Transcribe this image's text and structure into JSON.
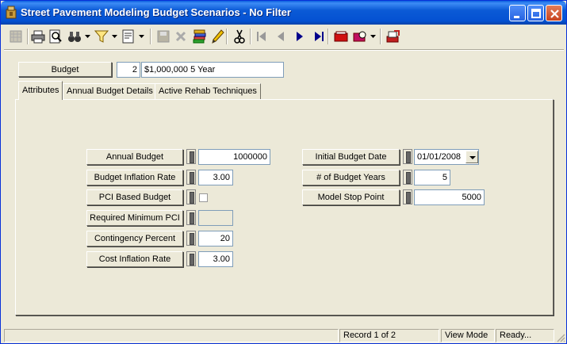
{
  "window": {
    "title": "Street Pavement Modeling Budget Scenarios - No Filter"
  },
  "toolbar": {
    "icons": [
      "grid-icon",
      "print-icon",
      "print-preview-icon",
      "binoculars-icon",
      "filter-icon",
      "form-icon",
      "save-icon",
      "delete-icon",
      "add-icon",
      "edit-icon",
      "cut-icon",
      "first-record-icon",
      "previous-record-icon",
      "next-record-icon",
      "last-record-icon",
      "book-icon",
      "book-view-icon",
      "exit-icon"
    ]
  },
  "header": {
    "budget_button": "Budget",
    "budget_id": "2",
    "budget_name": "$1,000,000 5 Year"
  },
  "tabs": [
    {
      "label": "Attributes"
    },
    {
      "label": "Annual Budget Details"
    },
    {
      "label": "Active Rehab Techniques"
    }
  ],
  "left_fields": {
    "annual_budget": {
      "label": "Annual Budget",
      "value": "1000000"
    },
    "budget_inflation_rate": {
      "label": "Budget Inflation Rate",
      "value": "3.00"
    },
    "pci_based_budget": {
      "label": "PCI Based Budget",
      "checked": false
    },
    "required_minimum_pci": {
      "label": "Required Minimum PCI",
      "value": ""
    },
    "contingency_percent": {
      "label": "Contingency Percent",
      "value": "20"
    },
    "cost_inflation_rate": {
      "label": "Cost Inflation Rate",
      "value": "3.00"
    }
  },
  "right_fields": {
    "initial_budget_date": {
      "label": "Initial Budget Date",
      "value": "01/01/2008"
    },
    "num_budget_years": {
      "label": "# of Budget Years",
      "value": "5"
    },
    "model_stop_point": {
      "label": "Model Stop Point",
      "value": "5000"
    }
  },
  "status": {
    "record": "Record 1 of 2",
    "mode": "View Mode",
    "state": "Ready..."
  },
  "colors": {
    "titlebar": "#0451d2",
    "window_bg": "#ece9d8"
  }
}
